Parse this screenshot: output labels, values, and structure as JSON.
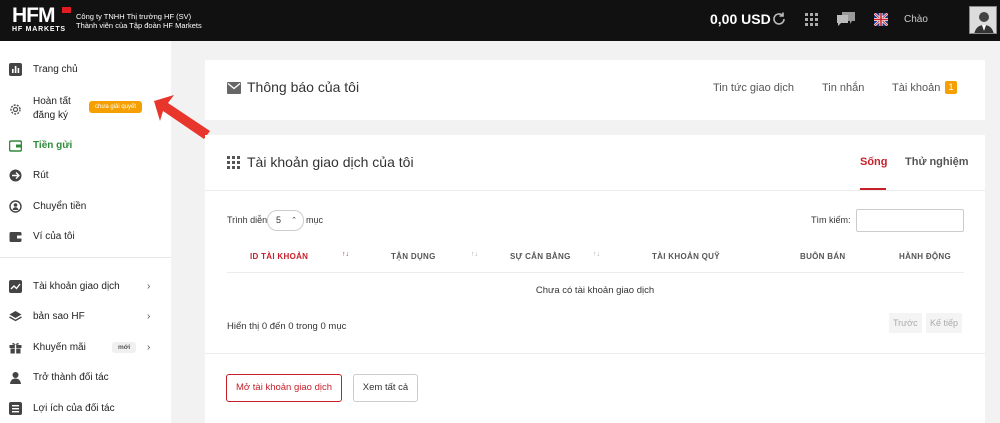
{
  "header": {
    "logo_text": "HFM",
    "logo_sub": "HF MARKETS",
    "company_line1": "Công ty TNHH Thị trường HF (SV)",
    "company_line2": "Thành viên của Tập đoàn HF Markets",
    "balance": "0,00 USD",
    "greeting": "Chào",
    "icons": [
      "refresh-icon",
      "apps-grid-icon",
      "chat-icon",
      "uk-flag-icon",
      "avatar"
    ]
  },
  "sidebar": {
    "items": [
      {
        "label": "Trang chủ",
        "icon": "bar-chart-icon"
      },
      {
        "label": "Hoàn tất",
        "label2": "đăng ký",
        "icon": "gear-icon",
        "badge": "chưa giải quyết"
      },
      {
        "label": "Tiền gửi",
        "icon": "wallet-deposit-icon",
        "active": true
      },
      {
        "label": "Rút",
        "icon": "withdraw-icon"
      },
      {
        "label": "Chuyển tiền",
        "icon": "transfer-icon"
      },
      {
        "label": "Ví của tôi",
        "icon": "wallet-icon"
      },
      {
        "label": "Tài khoản giao dịch",
        "icon": "trend-icon"
      },
      {
        "label": "bản sao HF",
        "icon": "layers-icon"
      },
      {
        "label": "Khuyến mãi",
        "icon": "gift-icon",
        "badge": "mới"
      },
      {
        "label": "Trở thành đối tác",
        "icon": "person-icon"
      },
      {
        "label": "Lợi ích của đối tác",
        "icon": "list-icon"
      }
    ]
  },
  "notifications": {
    "title": "Thông báo của tôi",
    "tabs": [
      "Tin tức giao dịch",
      "Tin nhắn",
      "Tài khoản"
    ],
    "account_count": "1"
  },
  "accounts": {
    "title": "Tài khoản giao dịch của tôi",
    "tab_live": "Sống",
    "tab_demo": "Thử nghiệm",
    "show_label": "Trình diễn",
    "entries_value": "5",
    "entries_suffix": "mục",
    "search_label": "Tìm kiếm:",
    "columns": [
      "ID TÀI KHOẢN",
      "TẬN DỤNG",
      "SỰ CÂN BẰNG",
      "TÀI KHOẢN QUỸ",
      "BUÔN BÁN",
      "HÀNH ĐỘNG"
    ],
    "empty_message": "Chưa có tài khoản giao dịch",
    "info": "Hiển thị 0 đến 0 trong 0 mục",
    "prev": "Trước",
    "next": "Kế tiếp",
    "open_button": "Mở tài khoản giao dịch",
    "view_all_button": "Xem tất cả"
  },
  "colors": {
    "accent_red": "#c8202a",
    "active_green": "#2e8b3a",
    "badge_orange": "#f5a000",
    "topbar": "#111111",
    "annotation_arrow": "#e8362c"
  }
}
